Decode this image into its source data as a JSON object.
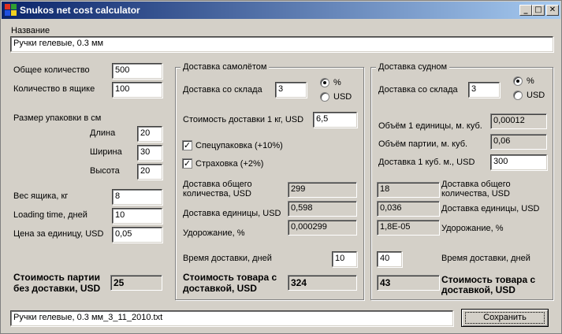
{
  "window": {
    "title": "Snukos net cost calculator"
  },
  "titlebar_buttons": {
    "minimize": "_",
    "maximize": "□",
    "close": "✕"
  },
  "name_section": {
    "label": "Название",
    "value": "Ручки гелевые, 0.3 мм"
  },
  "left": {
    "total_qty_label": "Общее количество",
    "total_qty": "500",
    "box_qty_label": "Количество в ящике",
    "box_qty": "100",
    "pack_size_label": "Размер упаковки в см",
    "length_label": "Длина",
    "length": "20",
    "width_label": "Ширина",
    "width": "30",
    "height_label": "Высота",
    "height": "20",
    "box_weight_label": "Вес ящика, кг",
    "box_weight": "8",
    "loading_time_label": "Loading time, дней",
    "loading_time": "10",
    "unit_price_label": "Цена за единицу, USD",
    "unit_price": "0,05",
    "batch_cost_label_1": "Стоимость партии",
    "batch_cost_label_2": "без доставки, USD",
    "batch_cost": "25"
  },
  "air": {
    "title": "Доставка самолётом",
    "warehouse_label": "Доставка со склада",
    "warehouse_value": "3",
    "radio_percent": "%",
    "radio_usd": "USD",
    "selected": "percent",
    "cost_per_kg_label": "Стоимость доставки 1 кг, USD",
    "cost_per_kg": "6,5",
    "special_pack_label": "Спецупаковка (+10%)",
    "special_pack_checked": true,
    "insurance_label": "Страховка (+2%)",
    "insurance_checked": true,
    "total_delivery_label_1": "Доставка общего",
    "total_delivery_label_2": "количества, USD",
    "total_delivery": "299",
    "unit_delivery_label": "Доставка единицы, USD",
    "unit_delivery": "0,598",
    "markup_label": "Удорожание, %",
    "markup": "0,000299",
    "delivery_time_label": "Время доставки, дней",
    "delivery_time": "10",
    "goods_cost_label_1": "Стоимость товара с",
    "goods_cost_label_2": "доставкой, USD",
    "goods_cost": "324"
  },
  "sea": {
    "title": "Доставка судном",
    "warehouse_label": "Доставка со склада",
    "warehouse_value": "3",
    "radio_percent": "%",
    "radio_usd": "USD",
    "selected": "percent",
    "unit_volume_label": "Объём 1 единицы, м. куб.",
    "unit_volume": "0,00012",
    "batch_volume_label": "Объём партии, м. куб.",
    "batch_volume": "0,06",
    "cost_per_m3_label": "Доставка 1 куб. м., USD",
    "cost_per_m3": "300",
    "total_delivery_label_1": "Доставка общего",
    "total_delivery_label_2": "количества, USD",
    "total_delivery": "18",
    "unit_delivery_label": "Доставка единицы, USD",
    "unit_delivery": "0,036",
    "markup_label": "Удорожание, %",
    "markup": "1,8E-05",
    "delivery_time_label": "Время доставки, дней",
    "delivery_time": "40",
    "goods_cost_label_1": "Стоимость товара с",
    "goods_cost_label_2": "доставкой, USD",
    "goods_cost": "43"
  },
  "footer": {
    "filename": "Ручки гелевые, 0.3 мм_3_11_2010.txt",
    "save_label": "Сохранить"
  },
  "colors": {
    "face": "#d4d0c8",
    "title_start": "#0a246a",
    "title_end": "#a6caf0"
  }
}
